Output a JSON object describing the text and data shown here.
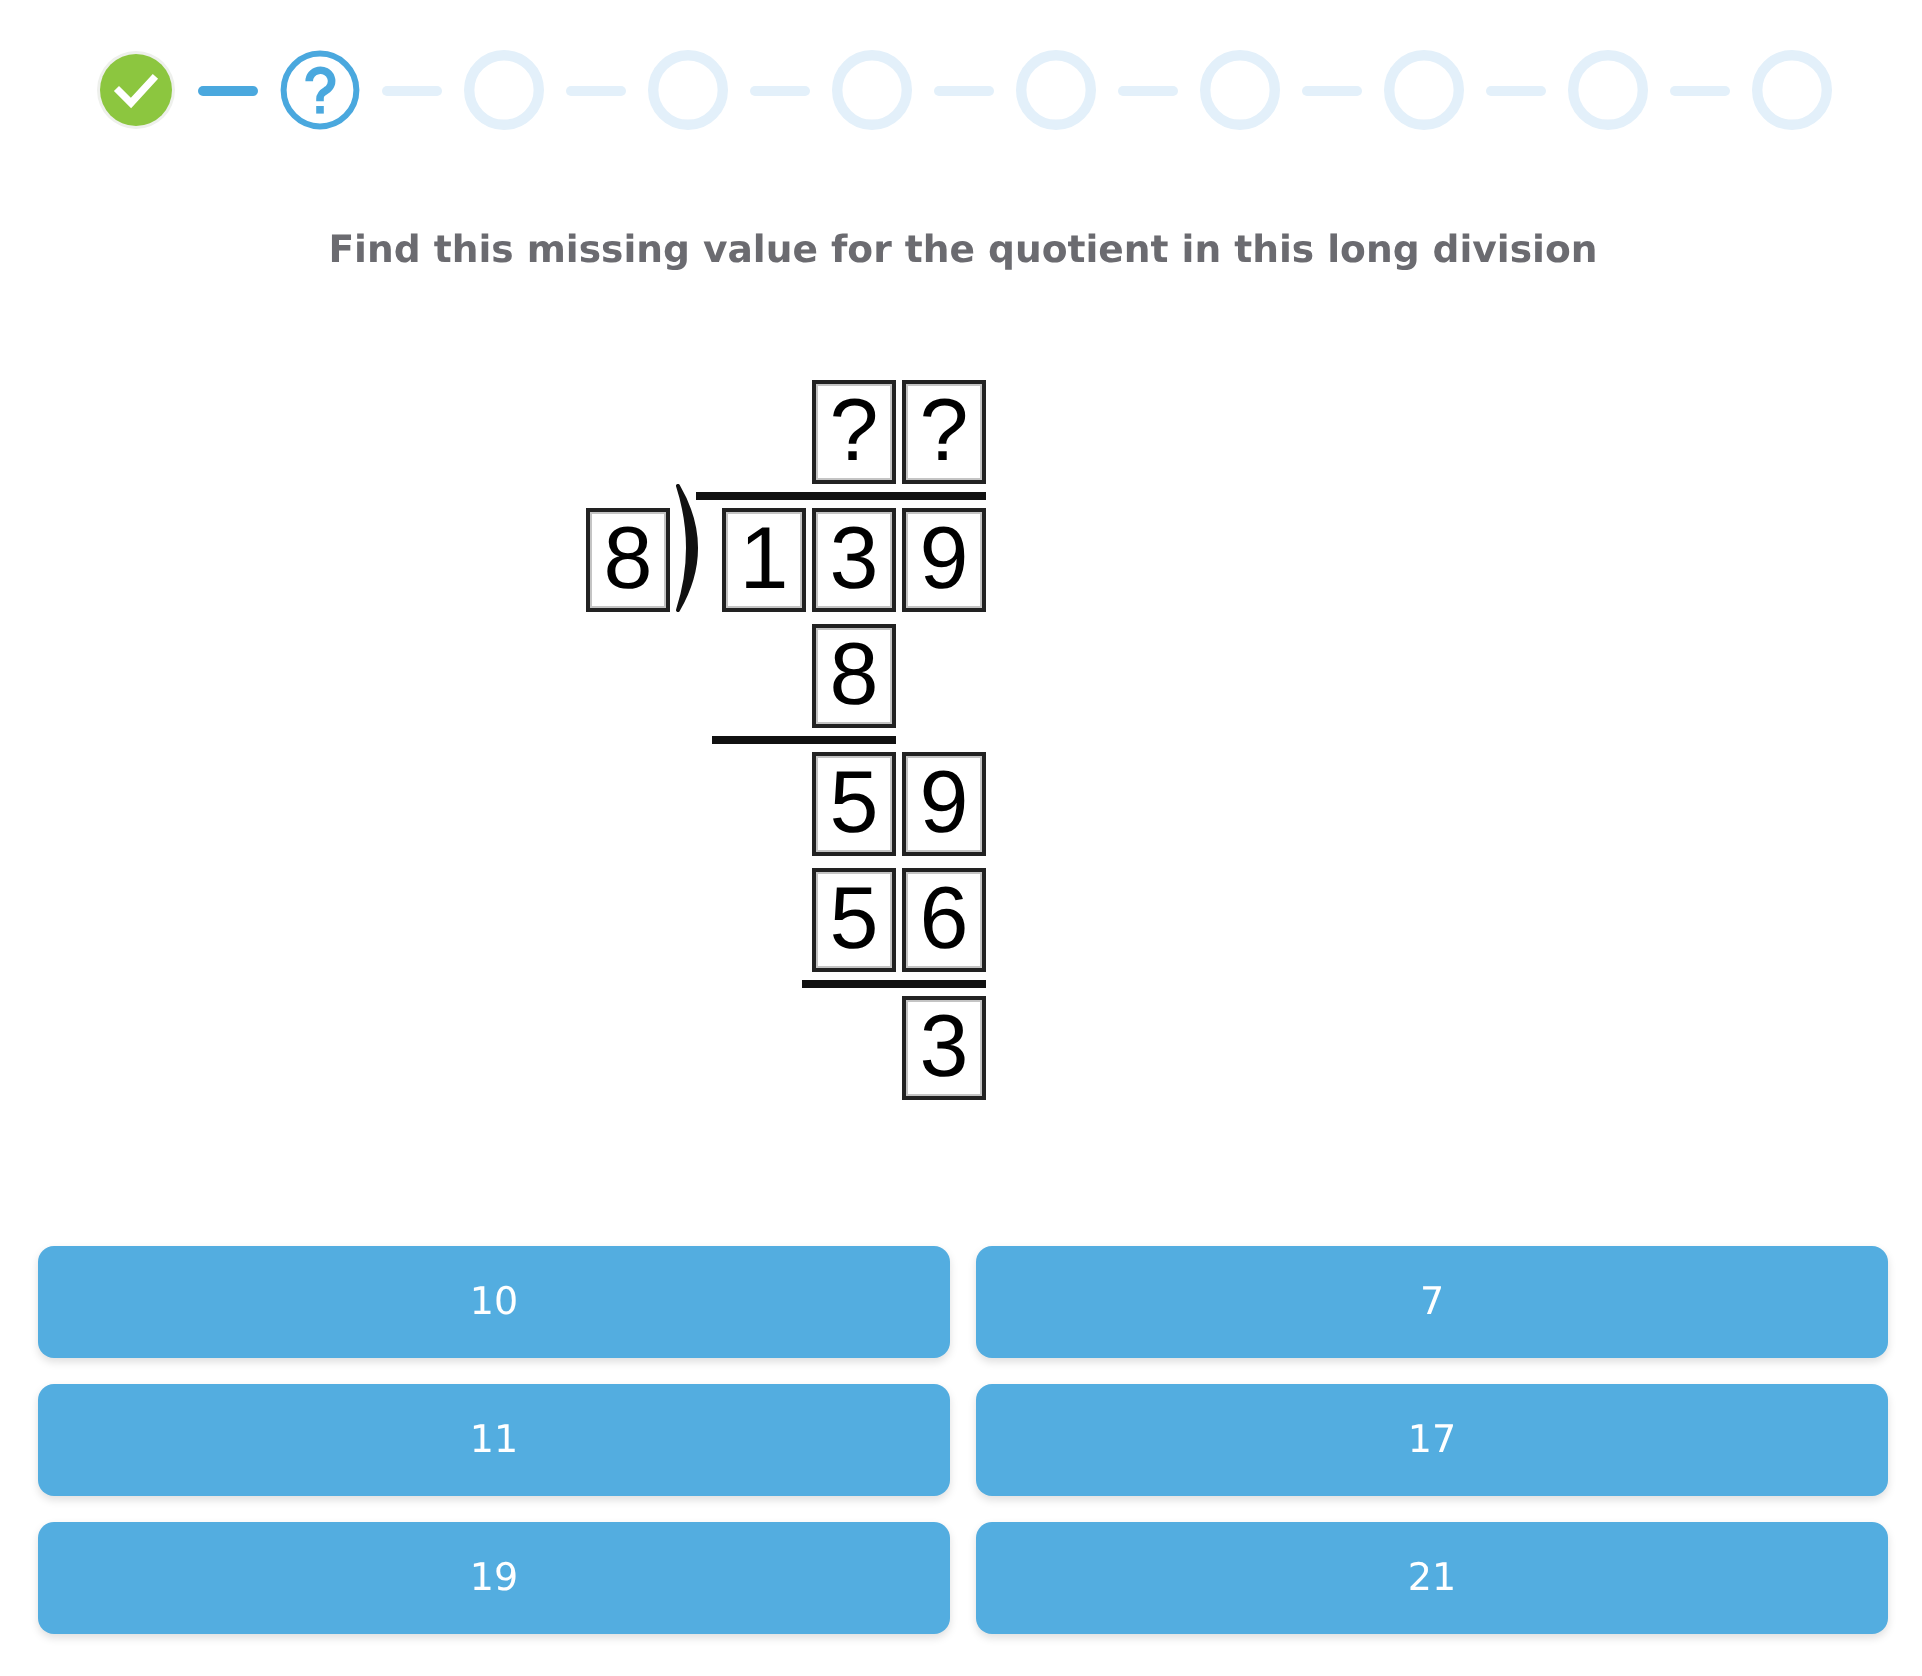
{
  "steps": [
    {
      "kind": "correct"
    },
    {
      "kind": "current"
    },
    {
      "kind": "pending"
    },
    {
      "kind": "pending"
    },
    {
      "kind": "pending"
    },
    {
      "kind": "pending"
    },
    {
      "kind": "pending"
    },
    {
      "kind": "pending"
    },
    {
      "kind": "pending"
    },
    {
      "kind": "pending"
    }
  ],
  "question": "Find this missing value for the quotient in this long division",
  "long_division": {
    "divisor": "8",
    "quotient": [
      "?",
      "?"
    ],
    "dividend": [
      "1",
      "3",
      "9"
    ],
    "work_rows": [
      {
        "digits": [
          "8"
        ],
        "shifted_left": true,
        "rule_below": true
      },
      {
        "digits": [
          "5",
          "9"
        ]
      },
      {
        "digits": [
          "5",
          "6"
        ],
        "rule_below": true
      },
      {
        "digits": [
          "3"
        ]
      }
    ]
  },
  "answers": [
    "10",
    "7",
    "11",
    "17",
    "19",
    "21"
  ]
}
